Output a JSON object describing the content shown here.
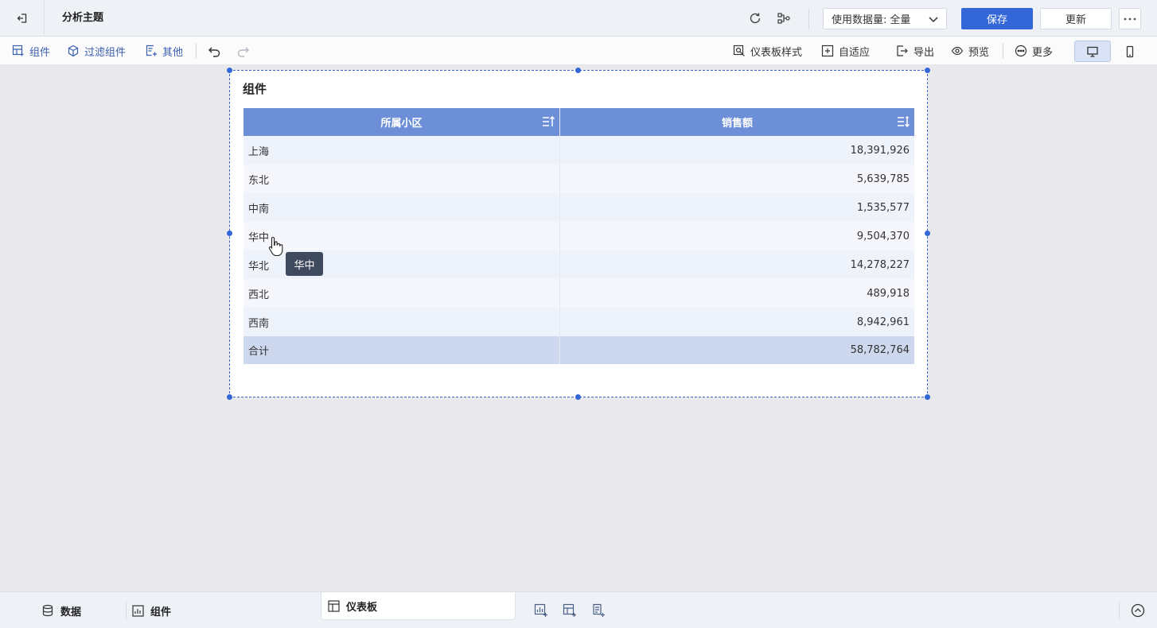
{
  "header": {
    "title": "分析主题",
    "data_select_label": "使用数据量:",
    "data_select_value": "全量",
    "save_label": "保存",
    "update_label": "更新"
  },
  "toolbar": {
    "component": "组件",
    "filter_component": "过滤组件",
    "other": "其他",
    "dashboard_style": "仪表板样式",
    "adaptive": "自适应",
    "export": "导出",
    "preview": "预览",
    "more": "更多"
  },
  "widget": {
    "title": "组件",
    "columns": [
      "所属小区",
      "销售额"
    ],
    "rows": [
      {
        "region": "上海",
        "sales": "18,391,926"
      },
      {
        "region": "东北",
        "sales": "5,639,785"
      },
      {
        "region": "中南",
        "sales": "1,535,577"
      },
      {
        "region": "华中",
        "sales": "9,504,370"
      },
      {
        "region": "华北",
        "sales": "14,278,227"
      },
      {
        "region": "西北",
        "sales": "489,918"
      },
      {
        "region": "西南",
        "sales": "8,942,961"
      }
    ],
    "total": {
      "label": "合计",
      "sales": "58,782,764"
    }
  },
  "tooltip": "华中",
  "bottom": {
    "data_tab": "数据",
    "component_tab": "组件",
    "dashboard_tab": "仪表板"
  },
  "colors": {
    "accent": "#3366d6",
    "table_header": "#6c8fd8",
    "total_row": "#cdd8ef"
  }
}
